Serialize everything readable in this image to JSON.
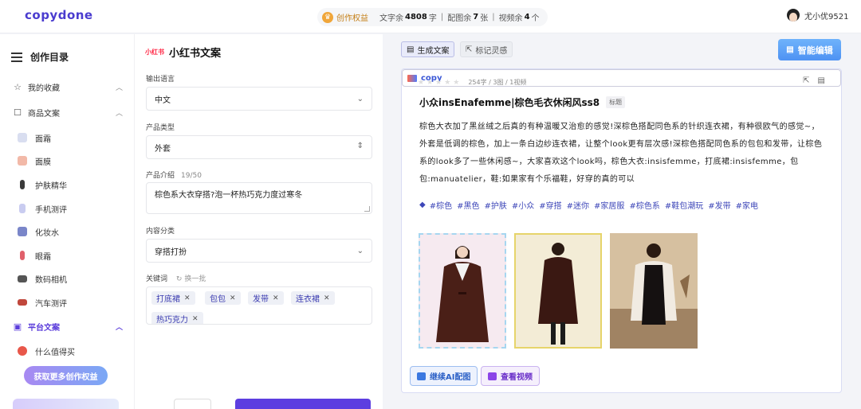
{
  "app": {
    "logo": "copydone"
  },
  "header": {
    "rights_label": "创作权益",
    "text_left_label": "文字余",
    "text_left_value": "4808",
    "text_left_unit": "字",
    "images_left_label": "配图余",
    "images_left_value": "7",
    "images_left_unit": "张",
    "videos_left_label": "视频余",
    "videos_left_value": "4",
    "videos_left_unit": "个",
    "separator": "|",
    "username": "尤小优9521"
  },
  "sidebar": {
    "title": "创作目录",
    "favorites": "我的收藏",
    "product_copy": "商品文案",
    "items": [
      "面霜",
      "面膜",
      "护肤精华",
      "手机测评",
      "化妆水",
      "眼霜",
      "数码相机",
      "汽车测评"
    ],
    "platform_copy": "平台文案",
    "platform_items": [
      "什么值得买"
    ],
    "upgrade_button": "获取更多创作权益"
  },
  "form": {
    "brand_logo": "小红书",
    "title": "小红书文案",
    "language_label": "输出语言",
    "language_value": "中文",
    "product_type_label": "产品类型",
    "product_type_value": "外套",
    "intro_label": "产品介绍",
    "intro_count": "19/50",
    "intro_value": "棕色系大衣穿搭?泡一杯热巧克力度过寒冬",
    "category_label": "内容分类",
    "category_value": "穿搭打扮",
    "keywords_label": "关键词",
    "keywords_refresh": "换一批",
    "keywords": [
      "打底裙",
      "包包",
      "发带",
      "连衣裙",
      "热巧克力"
    ]
  },
  "result": {
    "tab_generate": "生成文案",
    "tab_inspiration": "标记灵感",
    "smart_edit_button": "智能编辑",
    "meta": "254字 / 3图 / 1视频",
    "stars": "★★★★★",
    "title": "小众insEnafemme|棕色毛衣休闲风ss8",
    "title_badge": "标题",
    "body": "棕色大衣加了黑丝绒之后真的有种温暖又治愈的感觉!深棕色搭配同色系的针织连衣裙，有种很欧气的感觉~，外套是低调的棕色，加上一条白边纱连衣裙，让整个look更有层次感!深棕色搭配同色系的包包和发带，让棕色系的look多了一些休闲感~，大家喜欢这个look吗，棕色大衣:insisfemme，打底裙:insisfemme，包包:manuatelier，鞋:如果家有个乐福鞋，好穿的真的可以",
    "hashtags": [
      "#棕色",
      "#黑色",
      "#护肤",
      "#小众",
      "#穿搭",
      "#迷你",
      "#家居服",
      "#棕色系",
      "#鞋包潮玩",
      "#发带",
      "#家电"
    ],
    "continue_ai_button": "继续AI配图",
    "view_video_button": "查看视频",
    "copy_button": "copy"
  },
  "colors": {
    "brand": "#4a3ccf",
    "primary": "#5d3ee0",
    "accent_blue": "#4e92f3",
    "hashtag": "#3d46b8"
  }
}
